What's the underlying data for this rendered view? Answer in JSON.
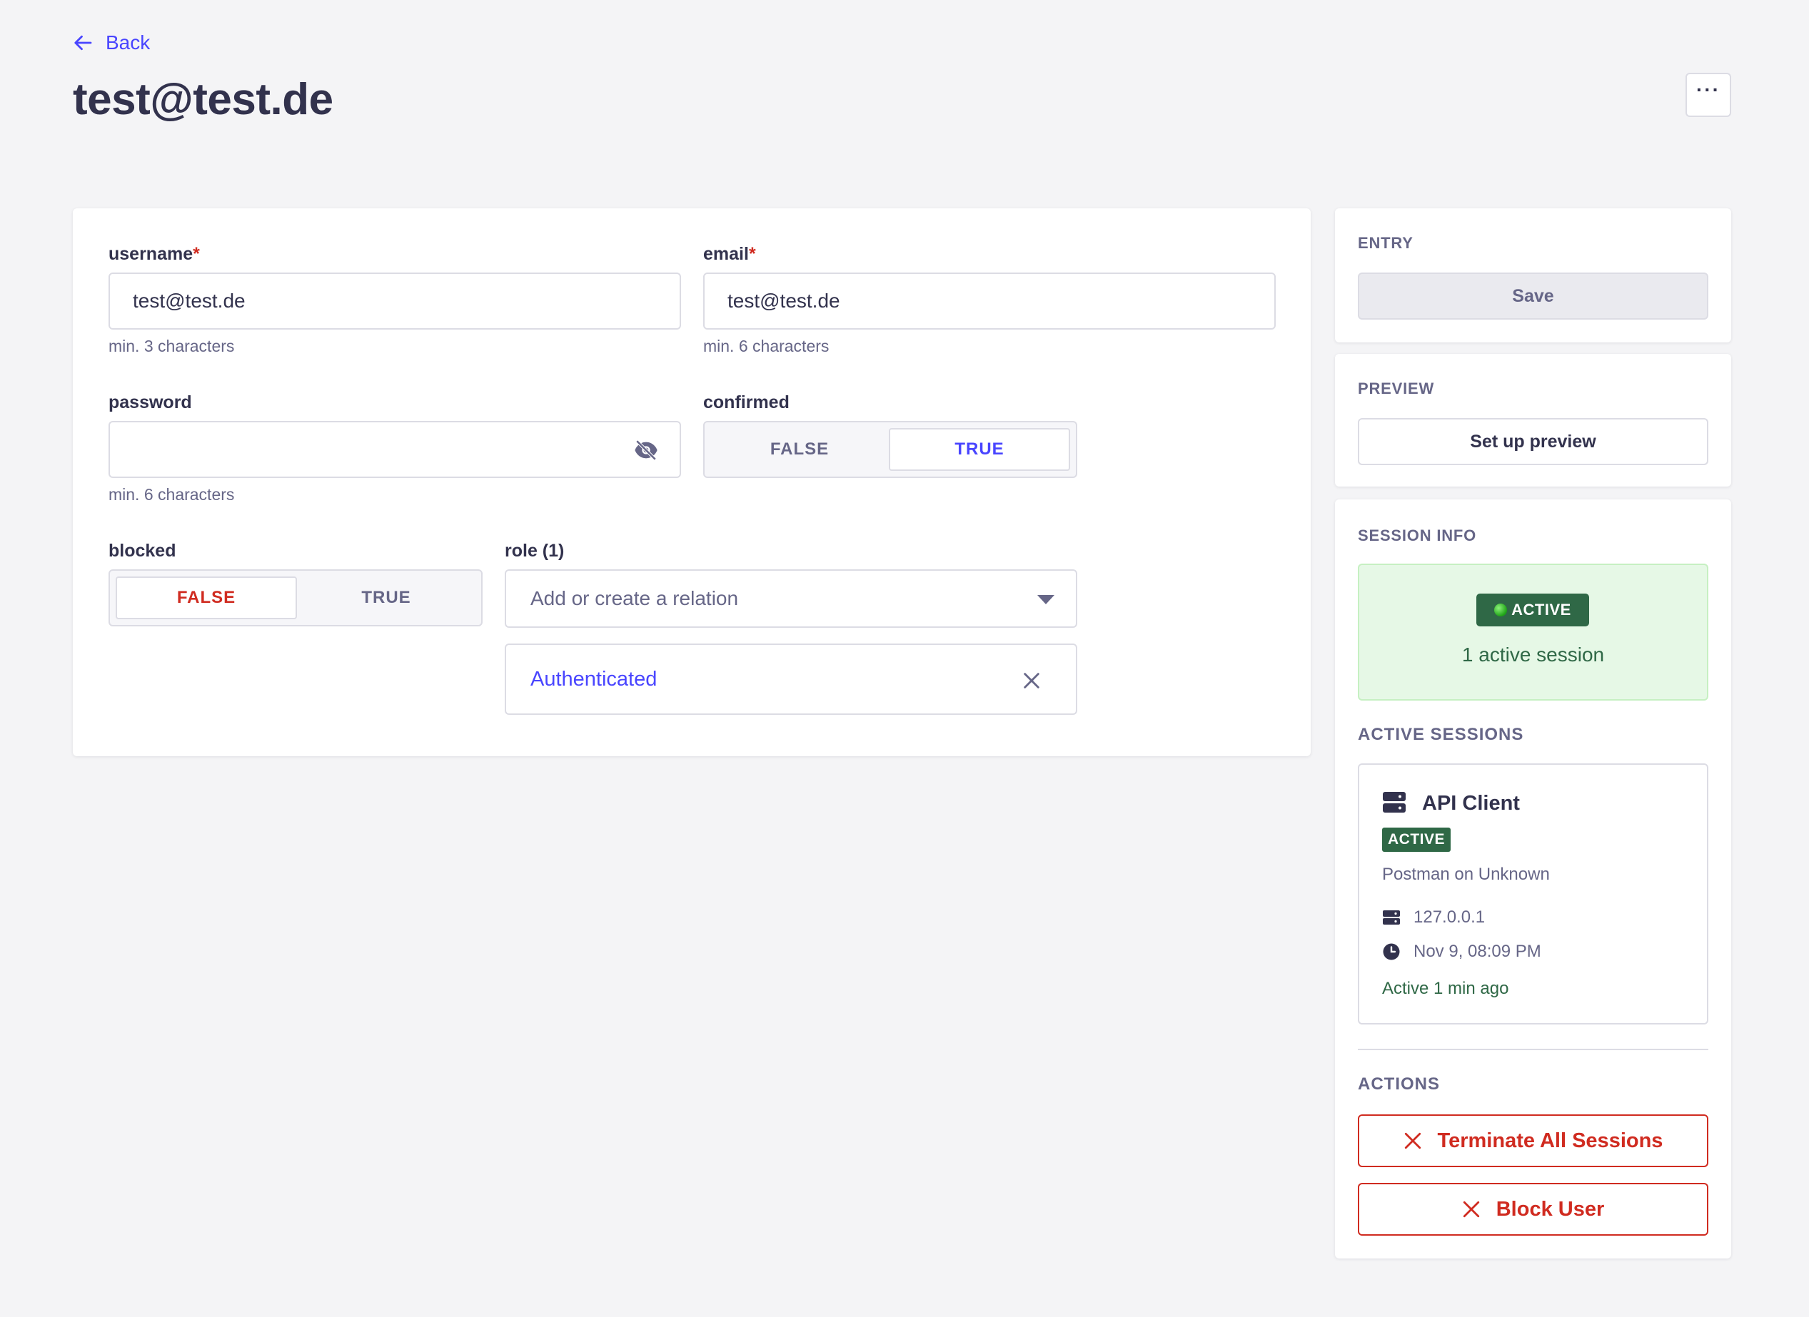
{
  "header": {
    "back_label": "Back",
    "title": "test@test.de",
    "more_label": "···"
  },
  "form": {
    "username": {
      "label": "username",
      "required_mark": "*",
      "value": "test@test.de",
      "hint": "min. 3 characters"
    },
    "email": {
      "label": "email",
      "required_mark": "*",
      "value": "test@test.de",
      "hint": "min. 6 characters"
    },
    "password": {
      "label": "password",
      "value": "",
      "hint": "min. 6 characters"
    },
    "confirmed": {
      "label": "confirmed",
      "false_label": "FALSE",
      "true_label": "TRUE",
      "value": true
    },
    "blocked": {
      "label": "blocked",
      "false_label": "FALSE",
      "true_label": "TRUE",
      "value": false
    },
    "role": {
      "label": "role (1)",
      "placeholder": "Add or create a relation",
      "items": [
        "Authenticated"
      ]
    }
  },
  "sidebar": {
    "entry": {
      "title": "ENTRY",
      "save_label": "Save"
    },
    "preview": {
      "title": "PREVIEW",
      "button_label": "Set up preview"
    },
    "session_info": {
      "title": "SESSION INFO",
      "status_badge": "ACTIVE",
      "session_count": "1 active session",
      "active_sessions_heading": "ACTIVE SESSIONS",
      "sessions": [
        {
          "client": "API Client",
          "badge": "ACTIVE",
          "description": "Postman on Unknown",
          "ip": "127.0.0.1",
          "time": "Nov 9, 08:09 PM",
          "last_active": "Active 1 min ago"
        }
      ],
      "actions_heading": "ACTIONS",
      "terminate_label": "Terminate All Sessions",
      "block_label": "Block User"
    }
  },
  "colors": {
    "primary": "#4945ff",
    "danger": "#d02b20",
    "success": "#2f6846",
    "success_bg": "#e6f8e6"
  }
}
